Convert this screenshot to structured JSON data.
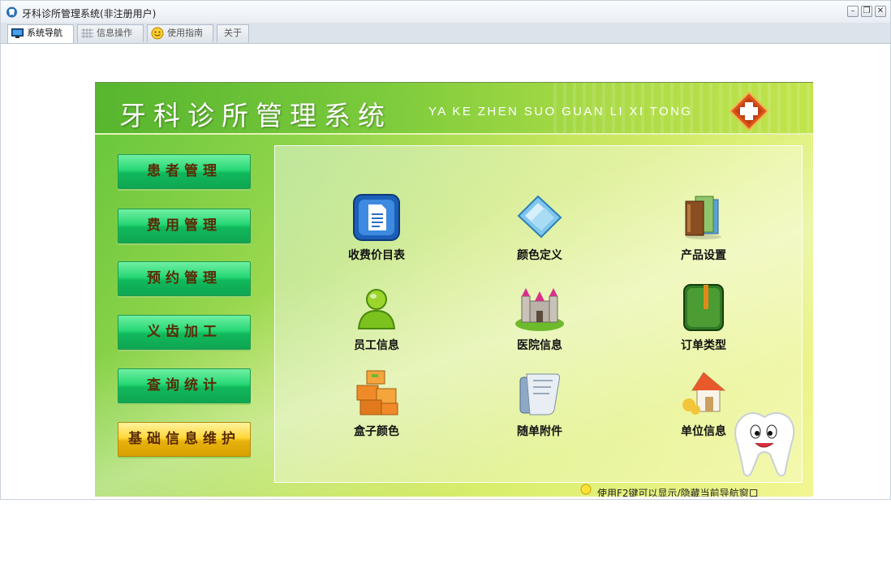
{
  "window": {
    "title": "牙科诊所管理系统(非注册用户)",
    "buttons": {
      "minimize": "–",
      "restore": "❐",
      "close": "✕"
    }
  },
  "tabs": [
    {
      "label": "系统导航",
      "icon": "monitor-icon",
      "active": true
    },
    {
      "label": "信息操作",
      "icon": "grid-icon",
      "active": false
    },
    {
      "label": "使用指南",
      "icon": "smiley-icon",
      "active": false
    },
    {
      "label": "关于",
      "icon": "",
      "active": false
    }
  ],
  "banner": {
    "title": "牙科诊所管理系统",
    "pinyin": "YA KE ZHEN SUO GUAN LI XI TONG",
    "logo": "red-cross-logo"
  },
  "nav": [
    {
      "label": "患者管理",
      "style": "green"
    },
    {
      "label": "费用管理",
      "style": "green"
    },
    {
      "label": "预约管理",
      "style": "green"
    },
    {
      "label": "义齿加工",
      "style": "green"
    },
    {
      "label": "查询统计",
      "style": "green"
    },
    {
      "label": "基础信息维护",
      "style": "gold"
    }
  ],
  "items": [
    {
      "label": "收费价目表",
      "icon": "document-icon"
    },
    {
      "label": "颜色定义",
      "icon": "color-card-icon"
    },
    {
      "label": "产品设置",
      "icon": "books-icon"
    },
    {
      "label": "员工信息",
      "icon": "user-icon"
    },
    {
      "label": "医院信息",
      "icon": "castle-icon"
    },
    {
      "label": "订单类型",
      "icon": "notebook-icon"
    },
    {
      "label": "盒子颜色",
      "icon": "boxes-icon"
    },
    {
      "label": "随单附件",
      "icon": "attachment-icon"
    },
    {
      "label": "单位信息",
      "icon": "house-icon"
    }
  ],
  "hint": {
    "text": "使用F2键可以显示/隐藏当前导航窗口"
  },
  "colors": {
    "nav_green": "#10b85c",
    "nav_gold": "#e8b20c",
    "nav_text": "#5a2a06",
    "banner": "#7ccb3c"
  }
}
